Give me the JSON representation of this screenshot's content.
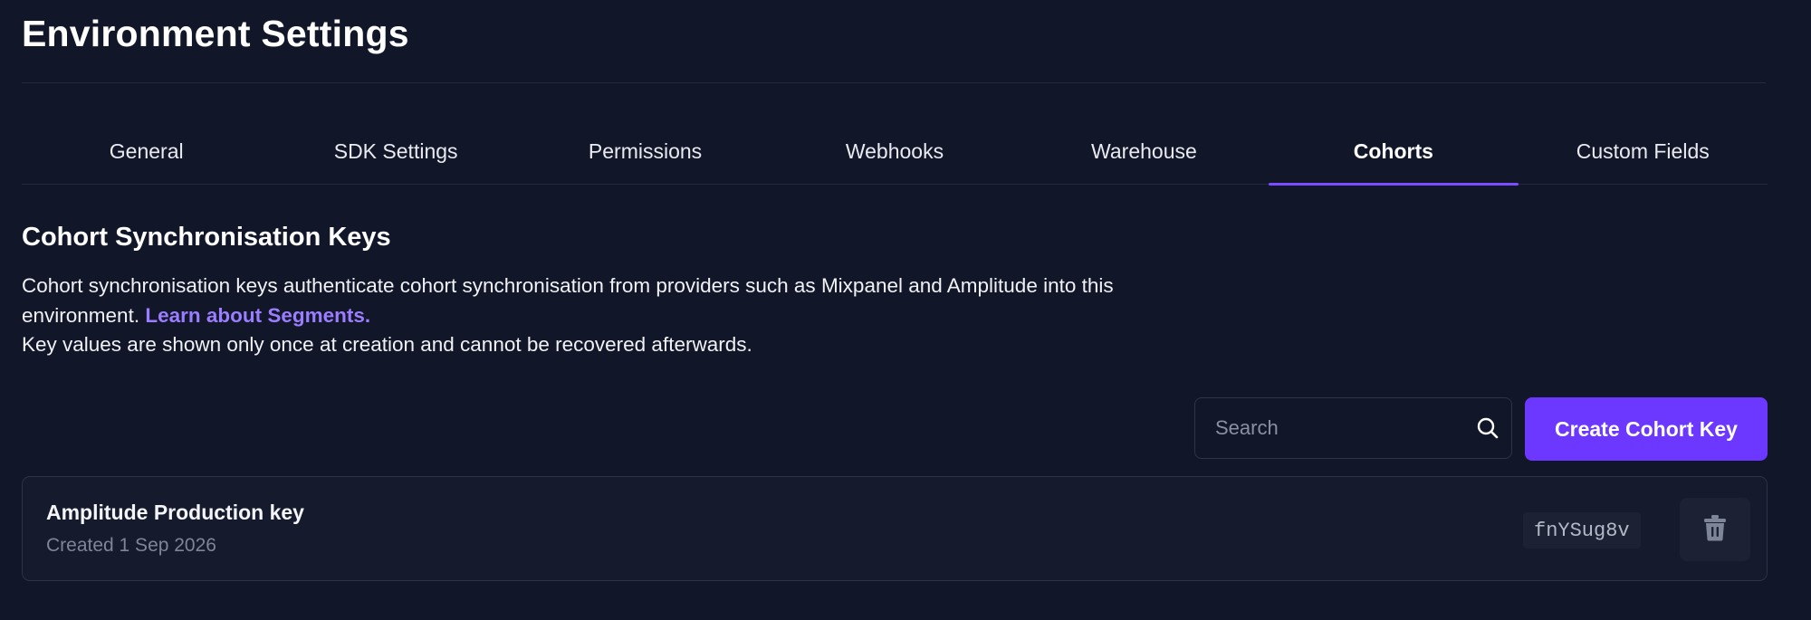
{
  "page": {
    "title": "Environment Settings"
  },
  "tabs": [
    {
      "label": "General",
      "active": false
    },
    {
      "label": "SDK Settings",
      "active": false
    },
    {
      "label": "Permissions",
      "active": false
    },
    {
      "label": "Webhooks",
      "active": false
    },
    {
      "label": "Warehouse",
      "active": false
    },
    {
      "label": "Cohorts",
      "active": true
    },
    {
      "label": "Custom Fields",
      "active": false
    }
  ],
  "section": {
    "title": "Cohort Synchronisation Keys",
    "description_part1": "Cohort synchronisation keys authenticate cohort synchronisation from providers such as Mixpanel and Amplitude into this environment.",
    "link_text": "Learn about Segments.",
    "description_part2": "Key values are shown only once at creation and cannot be recovered afterwards."
  },
  "search": {
    "value": "",
    "placeholder": "Search",
    "icon": "search-icon"
  },
  "actions": {
    "create_label": "Create Cohort Key"
  },
  "keys": [
    {
      "name": "Amplitude Production key",
      "created": "Created 1 Sep 2026",
      "value": "fnYSug8v",
      "delete_icon": "trash-icon"
    }
  ],
  "colors": {
    "background": "#111628",
    "accent": "#6c38ff",
    "active_tab_indicator": "#7c4dff",
    "link": "#9b7dff"
  }
}
